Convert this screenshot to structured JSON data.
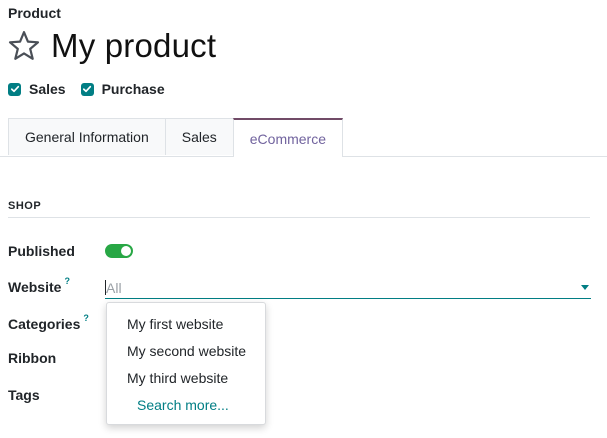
{
  "header": {
    "breadcrumb": "Product",
    "title": "My product",
    "star_icon": "star-outline-icon"
  },
  "options": [
    {
      "label": "Sales",
      "checked": true
    },
    {
      "label": "Purchase",
      "checked": true
    }
  ],
  "tabs": [
    {
      "label": "General Information",
      "active": false
    },
    {
      "label": "Sales",
      "active": false
    },
    {
      "label": "eCommerce",
      "active": true
    }
  ],
  "section": {
    "title": "SHOP"
  },
  "fields": {
    "published": {
      "label": "Published",
      "value": true
    },
    "website": {
      "label": "Website",
      "help": "?",
      "placeholder": "All",
      "value": ""
    },
    "categories": {
      "label": "Categories",
      "help": "?"
    },
    "ribbon": {
      "label": "Ribbon"
    },
    "tags": {
      "label": "Tags"
    }
  },
  "website_dropdown": {
    "items": [
      {
        "label": "My first website"
      },
      {
        "label": "My second website"
      },
      {
        "label": "My third website"
      }
    ],
    "search_more": "Search more..."
  },
  "colors": {
    "accent": "#017e84",
    "active_tab": "#714b67",
    "toggle_on": "#28a745"
  }
}
